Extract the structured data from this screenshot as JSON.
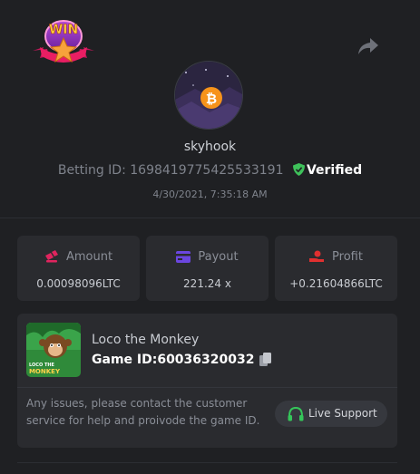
{
  "badge": {
    "text": "WIN"
  },
  "user": {
    "name": "skyhook",
    "betting_label": "Betting ID:",
    "betting_id": "1698419775425533191",
    "verified": "Verified",
    "date": "4/30/2021, 7:35:18 AM"
  },
  "stats": [
    {
      "label": "Amount",
      "value": "0.00098096LTC",
      "icon": "coins-icon",
      "color": "#e0245e"
    },
    {
      "label": "Payout",
      "value": "221.24 x",
      "icon": "card-icon",
      "color": "#6b46e0"
    },
    {
      "label": "Profit",
      "value": "+0.21604866LTC",
      "icon": "hand-coin-icon",
      "color": "#e03030"
    }
  ],
  "game": {
    "name": "Loco the Monkey",
    "id_label": "Game ID:",
    "id": "60036320032",
    "thumb_text_1": "LOCO THE",
    "thumb_text_2": "MONKEY"
  },
  "support": {
    "message": "Any issues, please contact the customer service for help and proivode the game ID.",
    "button": "Live Support"
  },
  "colors": {
    "background": "#1f2023",
    "card": "#2a2b2f",
    "verified_green": "#3ec15a",
    "support_green": "#35c65a"
  }
}
